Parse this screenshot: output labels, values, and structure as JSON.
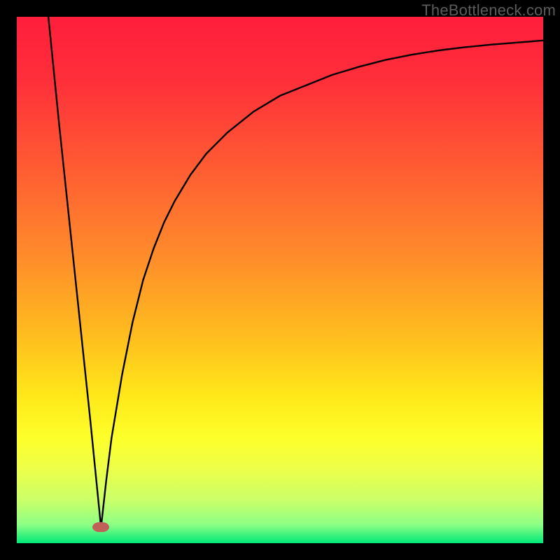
{
  "watermark": "TheBottleneck.com",
  "colors": {
    "frame": "#000000",
    "marker": "#c06058",
    "curve": "#000000",
    "gradient_stops": [
      {
        "offset": 0.0,
        "color": "#ff1e3c"
      },
      {
        "offset": 0.12,
        "color": "#ff2f3a"
      },
      {
        "offset": 0.28,
        "color": "#ff5a33"
      },
      {
        "offset": 0.45,
        "color": "#ff8a2b"
      },
      {
        "offset": 0.6,
        "color": "#ffbb1f"
      },
      {
        "offset": 0.72,
        "color": "#ffe81a"
      },
      {
        "offset": 0.8,
        "color": "#fdff2a"
      },
      {
        "offset": 0.86,
        "color": "#ecff4a"
      },
      {
        "offset": 0.92,
        "color": "#c9ff6a"
      },
      {
        "offset": 0.965,
        "color": "#8cff85"
      },
      {
        "offset": 1.0,
        "color": "#00e878"
      }
    ]
  },
  "chart_data": {
    "type": "line",
    "title": "",
    "xlabel": "",
    "ylabel": "",
    "xlim": [
      0,
      100
    ],
    "ylim": [
      0,
      100
    ],
    "grid": false,
    "legend": false,
    "annotations": [],
    "marker": {
      "x": 16,
      "y": 3
    },
    "series": [
      {
        "name": "curve",
        "x": [
          6,
          8,
          10,
          12,
          14,
          15,
          16,
          17,
          18,
          20,
          22,
          24,
          26,
          28,
          30,
          33,
          36,
          40,
          45,
          50,
          55,
          60,
          65,
          70,
          75,
          80,
          85,
          90,
          95,
          100
        ],
        "y": [
          100,
          80,
          61,
          42,
          23,
          13,
          3,
          12,
          20,
          32,
          42,
          50,
          56,
          61,
          65,
          70,
          74,
          78,
          82,
          85,
          87,
          89,
          90.5,
          91.8,
          92.8,
          93.6,
          94.2,
          94.7,
          95.1,
          95.5
        ]
      }
    ]
  }
}
